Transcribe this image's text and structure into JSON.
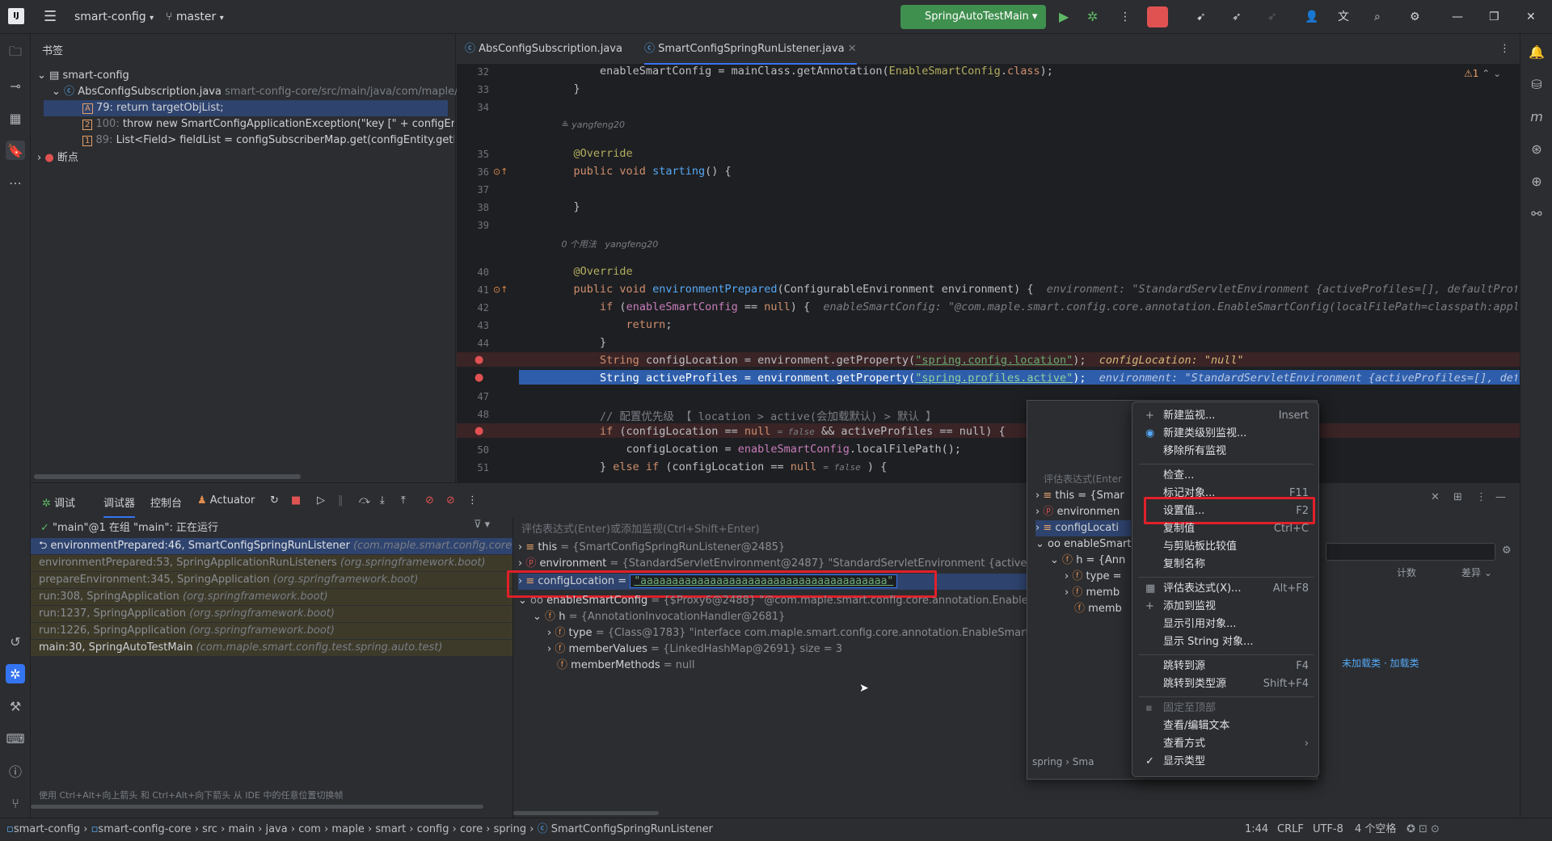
{
  "titlebar": {
    "project": "smart-config",
    "branch": "master",
    "run_config": "SpringAutoTestMain"
  },
  "bookmarks": {
    "title": "书签",
    "root": "smart-config",
    "file": "AbsConfigSubscription.java",
    "file_path": "smart-config-core/src/main/java/com/maple/s",
    "items": [
      {
        "badge": "A",
        "line": "79:",
        "text": "return targetObjList;"
      },
      {
        "badge": "2",
        "line": "100:",
        "text": "throw new SmartConfigApplicationException(\"key [\" + configEntity"
      },
      {
        "badge": "1",
        "line": "89:",
        "text": "List<Field> fieldList = configSubscriberMap.get(configEntity.getKe"
      }
    ],
    "breakpoints": "断点"
  },
  "editor": {
    "tabs": [
      "AbsConfigSubscription.java",
      "SmartConfigSpringRunListener.java"
    ],
    "warning_count": "1",
    "lines": [
      {
        "n": "32",
        "code": "        enableSmartConfig = mainClass.getAnnotation(EnableSmartConfig.class);"
      },
      {
        "n": "33",
        "code": "    }"
      },
      {
        "n": "34",
        "code": ""
      },
      {
        "n": "",
        "code": "yangfeng20"
      },
      {
        "n": "35",
        "code": "    @Override"
      },
      {
        "n": "36",
        "code": "    public void starting() {"
      },
      {
        "n": "37",
        "code": ""
      },
      {
        "n": "38",
        "code": "    }"
      },
      {
        "n": "39",
        "code": ""
      },
      {
        "n": "",
        "code": "0 个用法   yangfeng20"
      },
      {
        "n": "40",
        "code": "    @Override"
      },
      {
        "n": "41",
        "code": "    public void environmentPrepared(ConfigurableEnvironment environment) {"
      },
      {
        "n": "42",
        "code": "        if (enableSmartConfig == null) {"
      },
      {
        "n": "43",
        "code": "            return;"
      },
      {
        "n": "44",
        "code": "        }"
      },
      {
        "n": "45",
        "code": "        String configLocation = environment.getProperty(\"spring.config.location\");"
      },
      {
        "n": "46",
        "code": "        String activeProfiles = environment.getProperty(\"spring.profiles.active\");"
      },
      {
        "n": "47",
        "code": ""
      },
      {
        "n": "48",
        "code": "        // 配置优先级 【 location > active(会加载默认) > 默认 】"
      },
      {
        "n": "49",
        "code": "        if (configLocation == null"
      },
      {
        "n": "50",
        "code": "            configLocation = enableSmartConfig.localFilePath();"
      },
      {
        "n": "51",
        "code": "        } else if (configLocation == null"
      }
    ],
    "hints": {
      "l41": "environment: \"StandardServletEnvironment {activeProfiles=[], defaultProfiles=[",
      "l42": "enableSmartConfig: \"@com.maple.smart.config.core.annotation.EnableSmartConfig(localFilePath=classpath:applicatio",
      "l45": "configLocation: \"null\"",
      "l46": "environment: \"StandardServletEnvironment {activeProfiles=[], defaultPr",
      "l49a": "= false",
      "l49b": "&& activeProfiles == null) {",
      "l51a": "= false",
      "l51b": ") {"
    }
  },
  "debug": {
    "tabs": [
      "调试",
      "调试器",
      "控制台",
      "Actuator"
    ],
    "thread": "\"main\"@1 在组 \"main\": 正在运行",
    "frames": [
      {
        "m": "environmentPrepared:46, SmartConfigSpringRunListener",
        "c": "(com.maple.smart.config.core.sp"
      },
      {
        "m": "environmentPrepared:53, SpringApplicationRunListeners",
        "c": "(org.springframework.boot)"
      },
      {
        "m": "prepareEnvironment:345, SpringApplication",
        "c": "(org.springframework.boot)"
      },
      {
        "m": "run:308, SpringApplication",
        "c": "(org.springframework.boot)"
      },
      {
        "m": "run:1237, SpringApplication",
        "c": "(org.springframework.boot)"
      },
      {
        "m": "run:1226, SpringApplication",
        "c": "(org.springframework.boot)"
      },
      {
        "m": "main:30, SpringAutoTestMain",
        "c": "(com.maple.smart.config.test.spring.auto.test)"
      }
    ],
    "frames_hint": "使用 Ctrl+Alt+向上箭头 和 Ctrl+Alt+向下箭头 从 IDE 中的任意位置切换帧",
    "eval_placeholder": "评估表达式(Enter)或添加监视(Ctrl+Shift+Enter)",
    "vars": [
      {
        "name": "this",
        "val": "= {SmartConfigSpringRunListener@2485}"
      },
      {
        "name": "environment",
        "val": "= {StandardServletEnvironment@2487} \"StandardServletEnvironment {activeProfil"
      },
      {
        "name": "configLocation =",
        "val": "\"aaaaaaaaaaaaaaaaaaaaaaaaaaaaaaaaaaaaaaa\""
      },
      {
        "name": "enableSmartConfig",
        "val": "= {$Proxy6@2488} \"@com.maple.smart.config.core.annotation.EnableSmart"
      },
      {
        "name": "h",
        "val": "= {AnnotationInvocationHandler@2681}"
      },
      {
        "name": "type",
        "val": "= {Class@1783} \"interface com.maple.smart.config.core.annotation.EnableSmartCon"
      },
      {
        "name": "memberValues",
        "val": "= {LinkedHashMap@2691}  size = 3"
      },
      {
        "name": "memberMethods",
        "val": "= null"
      }
    ]
  },
  "popup": {
    "eval": "评估表达式(Enter",
    "vars": [
      "this = {Smar",
      "environmen",
      "configLocati",
      "enableSmart",
      "h = {Ann",
      "type =",
      "memb",
      "memb"
    ],
    "count": "计数",
    "diff": "差异",
    "unloaded": "未加载类 · 加载类",
    "crumb": "spring › Sma"
  },
  "context_menu": {
    "items": [
      {
        "label": "新建监视...",
        "sc": "Insert",
        "ic": "+"
      },
      {
        "label": "新建类级别监视...",
        "sc": "",
        "ic": "◉"
      },
      {
        "label": "移除所有监视",
        "sc": "",
        "ic": ""
      },
      {
        "label": "检查...",
        "sc": "",
        "ic": ""
      },
      {
        "label": "标记对象...",
        "sc": "F11",
        "ic": ""
      },
      {
        "label": "设置值...",
        "sc": "F2",
        "ic": ""
      },
      {
        "label": "复制值",
        "sc": "Ctrl+C",
        "ic": ""
      },
      {
        "label": "与剪贴板比较值",
        "sc": "",
        "ic": ""
      },
      {
        "label": "复制名称",
        "sc": "",
        "ic": ""
      },
      {
        "label": "评估表达式(X)...",
        "sc": "Alt+F8",
        "ic": "▦"
      },
      {
        "label": "添加到监视",
        "sc": "",
        "ic": "+"
      },
      {
        "label": "显示引用对象...",
        "sc": "",
        "ic": ""
      },
      {
        "label": "显示 String 对象...",
        "sc": "",
        "ic": ""
      },
      {
        "label": "跳转到源",
        "sc": "F4",
        "ic": ""
      },
      {
        "label": "跳转到类型源",
        "sc": "Shift+F4",
        "ic": ""
      },
      {
        "label": "固定至顶部",
        "sc": "",
        "ic": ""
      },
      {
        "label": "查看/编辑文本",
        "sc": "",
        "ic": ""
      },
      {
        "label": "查看方式",
        "sc": "›",
        "ic": ""
      },
      {
        "label": "显示类型",
        "sc": "",
        "ic": "✓"
      }
    ]
  },
  "status": {
    "crumbs": [
      "smart-config",
      "smart-config-core",
      "src",
      "main",
      "java",
      "com",
      "maple",
      "smart",
      "config",
      "core",
      "spring",
      "SmartConfigSpringRunListener"
    ],
    "pos": "1:44",
    "eol": "CRLF",
    "enc": "UTF-8",
    "indent": "4 个空格"
  },
  "colors": {
    "accent": "#3574f0",
    "run": "#3f8f4e",
    "stop": "#e05252",
    "highlight": "#e0202a"
  }
}
